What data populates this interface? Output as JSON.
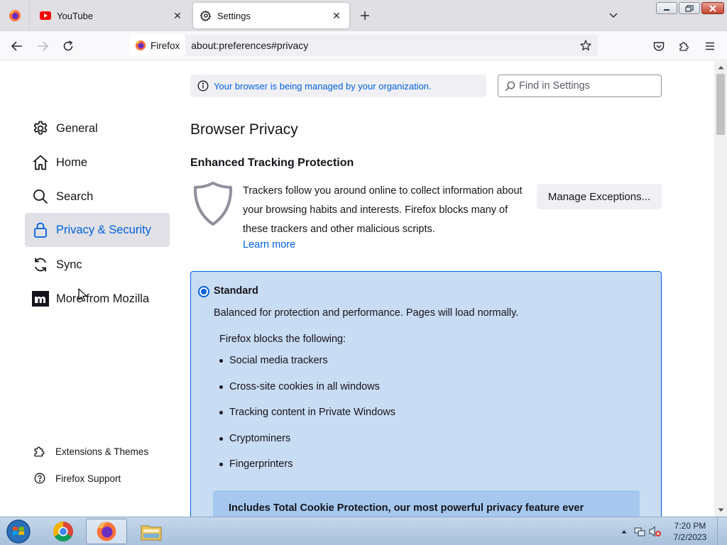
{
  "tabs": [
    {
      "title": "YouTube",
      "icon": "youtube-icon",
      "active": false
    },
    {
      "title": "Settings",
      "icon": "gear-icon",
      "active": true
    }
  ],
  "navbar": {
    "identity_label": "Firefox",
    "url": "about:preferences#privacy"
  },
  "sidebar": {
    "items": [
      {
        "label": "General",
        "icon": "gear-icon"
      },
      {
        "label": "Home",
        "icon": "home-icon"
      },
      {
        "label": "Search",
        "icon": "search-icon"
      },
      {
        "label": "Privacy & Security",
        "icon": "lock-icon",
        "selected": true
      },
      {
        "label": "Sync",
        "icon": "sync-icon"
      },
      {
        "label": "More from Mozilla",
        "icon": "mozilla-icon"
      }
    ],
    "footer": [
      {
        "label": "Extensions & Themes",
        "icon": "puzzle-icon"
      },
      {
        "label": "Firefox Support",
        "icon": "help-icon"
      }
    ]
  },
  "main": {
    "policies_notice": "Your browser is being managed by your organization.",
    "search_placeholder": "Find in Settings",
    "page_title": "Browser Privacy",
    "etp": {
      "title": "Enhanced Tracking Protection",
      "description": "Trackers follow you around online to collect information about your browsing habits and interests. Firefox blocks many of these trackers and other malicious scripts.",
      "learn_more": "Learn more",
      "manage_exceptions": "Manage Exceptions..."
    },
    "standard": {
      "label": "Standard",
      "description": "Balanced for protection and performance. Pages will load normally.",
      "blocks_title": "Firefox blocks the following:",
      "blocks": [
        "Social media trackers",
        "Cross-site cookies in all windows",
        "Tracking content in Private Windows",
        "Cryptominers",
        "Fingerprinters"
      ],
      "tcp_text": "Includes Total Cookie Protection, our most powerful privacy feature ever"
    }
  },
  "taskbar": {
    "apps": [
      "chrome-icon",
      "firefox-icon",
      "file-explorer-icon"
    ],
    "time": "7:20 PM",
    "date": "7/2/2023"
  },
  "colors": {
    "accent": "#0061e0",
    "selected_bg": "#e0e0e6",
    "standard_bg": "#c8dcf3"
  }
}
